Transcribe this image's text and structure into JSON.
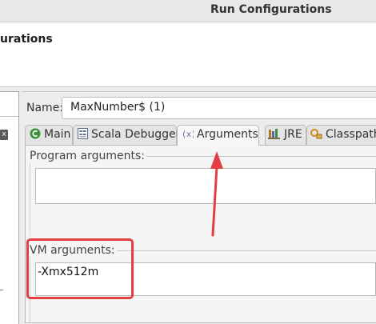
{
  "window": {
    "title": "Run Configurations"
  },
  "header": {
    "title": "urations"
  },
  "left_panel": {
    "filter_clear_glyph": "x"
  },
  "config": {
    "name_label": "Name:",
    "name_value": "MaxNumber$ (1)"
  },
  "tabs": [
    {
      "label": "Main",
      "icon": "scala-main-icon",
      "active": false
    },
    {
      "label": "Scala Debugger",
      "icon": "debugger-icon",
      "active": false
    },
    {
      "label": "Arguments",
      "icon": "variable-x-icon",
      "active": true
    },
    {
      "label": "JRE",
      "icon": "jre-library-icon",
      "active": false
    },
    {
      "label": "Classpath",
      "icon": "classpath-icon",
      "active": false
    }
  ],
  "arguments": {
    "program_label": "Program arguments:",
    "program_value": "",
    "vm_label": "VM arguments:",
    "vm_value": "-Xmx512m"
  },
  "annotation": {
    "color": "#e53d44"
  }
}
